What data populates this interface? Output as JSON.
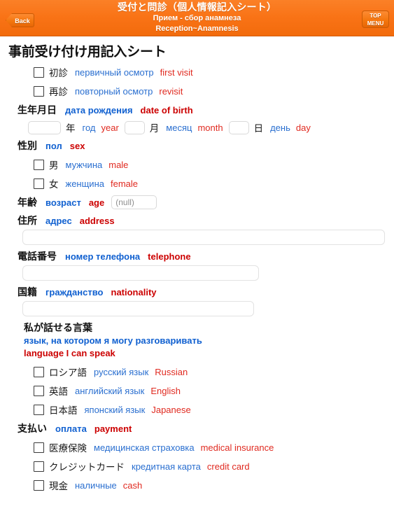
{
  "header": {
    "title_ja": "受付と問診（個人情報記入シート）",
    "title_ru": "Прием - сбор анамнеза",
    "title_en": "Reception~Anamnesis",
    "back_label": "Back",
    "top_menu_label": "TOP\nMENU",
    "top_menu_line1": "TOP",
    "top_menu_line2": "MENU",
    "background_color": "#f97316"
  },
  "page": {
    "title": "事前受け付け用記入シート"
  },
  "colors": {
    "japanese": "#111111",
    "russian": "#1060d0",
    "english": "#cc0000",
    "russian_light": "#2a6fd0",
    "english_light": "#e02a20",
    "accent": "#f97316"
  },
  "visit_type": {
    "options": [
      {
        "ja": "初診",
        "ru": "первичный осмотр",
        "en": "first visit",
        "checked": false
      },
      {
        "ja": "再診",
        "ru": "повторный осмотр",
        "en": "revisit",
        "checked": false
      }
    ]
  },
  "date_of_birth": {
    "label_ja": "生年月日",
    "label_ru": "дата рождения",
    "label_en": "date of birth",
    "year": {
      "value": "",
      "unit_ja": "年",
      "unit_ru": "год",
      "unit_en": "year"
    },
    "month": {
      "value": "",
      "unit_ja": "月",
      "unit_ru": "месяц",
      "unit_en": "month"
    },
    "day": {
      "value": "",
      "unit_ja": "日",
      "unit_ru": "день",
      "unit_en": "day"
    }
  },
  "sex": {
    "label_ja": "性別",
    "label_ru": "пол",
    "label_en": "sex",
    "options": [
      {
        "ja": "男",
        "ru": "мужчина",
        "en": "male",
        "checked": false
      },
      {
        "ja": "女",
        "ru": "женщина",
        "en": "female",
        "checked": false
      }
    ]
  },
  "age": {
    "label_ja": "年齢",
    "label_ru": "возраст",
    "label_en": "age",
    "value": "",
    "placeholder": "(null)"
  },
  "address": {
    "label_ja": "住所",
    "label_ru": "адрес",
    "label_en": "address",
    "value": "",
    "placeholder": ""
  },
  "telephone": {
    "label_ja": "電話番号",
    "label_ru": "номер телефона",
    "label_en": "telephone",
    "value": "",
    "placeholder": ""
  },
  "nationality": {
    "label_ja": "国籍",
    "label_ru": "гражданство",
    "label_en": "nationality",
    "value": "",
    "placeholder": ""
  },
  "language": {
    "label_ja": "私が話せる言葉",
    "label_ru": "язык, на котором я могу разговаривать",
    "label_en": "language I can speak",
    "options": [
      {
        "ja": "ロシア語",
        "ru": "русский язык",
        "en": "Russian",
        "checked": false
      },
      {
        "ja": "英語",
        "ru": "английский язык",
        "en": "English",
        "checked": false
      },
      {
        "ja": "日本語",
        "ru": "японский язык",
        "en": "Japanese",
        "checked": false
      }
    ]
  },
  "payment": {
    "label_ja": "支払い",
    "label_ru": "оплата",
    "label_en": "payment",
    "options": [
      {
        "ja": "医療保険",
        "ru": "медицинская страховка",
        "en": "medical insurance",
        "checked": false
      },
      {
        "ja": "クレジットカード",
        "ru": "кредитная карта",
        "en": "credit card",
        "checked": false
      },
      {
        "ja": "現金",
        "ru": "наличные",
        "en": "cash",
        "checked": false
      }
    ]
  }
}
